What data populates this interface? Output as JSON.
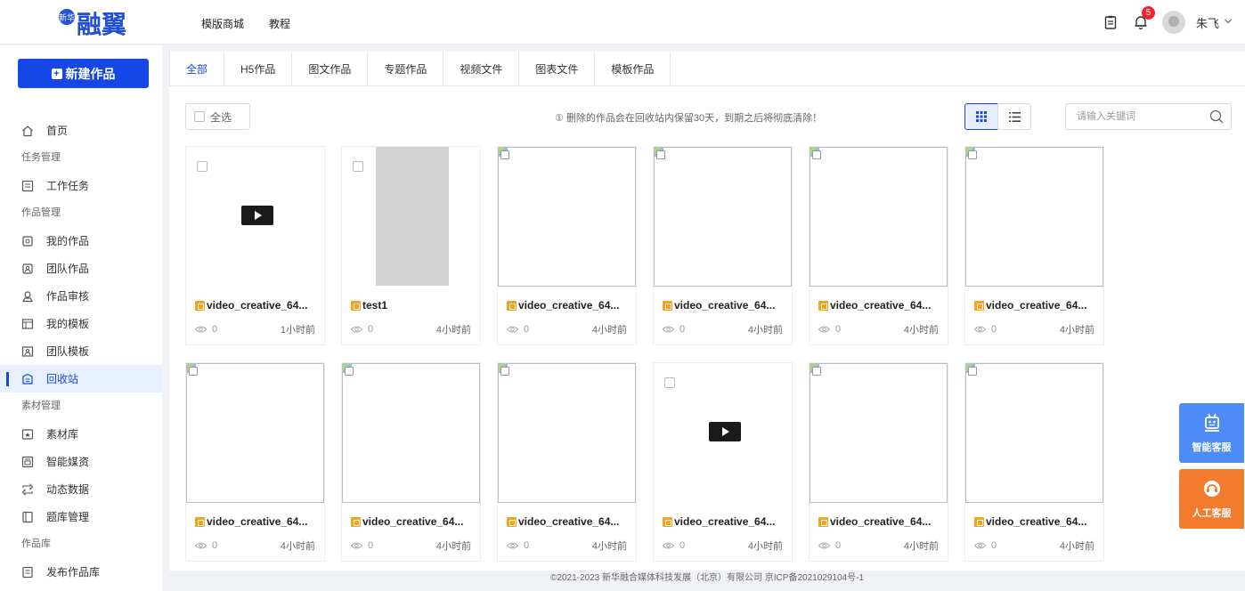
{
  "header": {
    "logo_mark": "新华",
    "logo_text": "融翼",
    "nav": [
      "模版商城",
      "教程"
    ],
    "notification_count": "5",
    "user_name": "朱飞"
  },
  "sidebar": {
    "new_button": "新建作品",
    "menu": [
      {
        "type": "item",
        "label": "首页",
        "icon": "home-icon"
      },
      {
        "type": "section",
        "label": "任务管理"
      },
      {
        "type": "item",
        "label": "工作任务",
        "icon": "task-icon"
      },
      {
        "type": "section",
        "label": "作品管理"
      },
      {
        "type": "item",
        "label": "我的作品",
        "icon": "my-works-icon"
      },
      {
        "type": "item",
        "label": "团队作品",
        "icon": "team-works-icon"
      },
      {
        "type": "item",
        "label": "作品审核",
        "icon": "review-icon"
      },
      {
        "type": "item",
        "label": "我的模板",
        "icon": "my-template-icon"
      },
      {
        "type": "item",
        "label": "团队模板",
        "icon": "team-template-icon"
      },
      {
        "type": "item",
        "label": "回收站",
        "icon": "recycle-bin-icon",
        "active": true
      },
      {
        "type": "section",
        "label": "素材管理"
      },
      {
        "type": "item",
        "label": "素材库",
        "icon": "material-library-icon"
      },
      {
        "type": "item",
        "label": "智能媒资",
        "icon": "smart-media-icon"
      },
      {
        "type": "item",
        "label": "动态数据",
        "icon": "dynamic-data-icon"
      },
      {
        "type": "item",
        "label": "题库管理",
        "icon": "question-bank-icon"
      },
      {
        "type": "section",
        "label": "作品库"
      },
      {
        "type": "item",
        "label": "发布作品库",
        "icon": "publish-library-icon"
      }
    ]
  },
  "tabs": [
    {
      "label": "全部",
      "active": true
    },
    {
      "label": "H5作品"
    },
    {
      "label": "图文作品"
    },
    {
      "label": "专题作品"
    },
    {
      "label": "视频文件"
    },
    {
      "label": "图表文件"
    },
    {
      "label": "模板作品"
    }
  ],
  "toolbar": {
    "select_all": "全选",
    "notice": "① 删除的作品会在回收站内保留30天，到期之后将彻底清除！",
    "search_placeholder": "请输入关键词"
  },
  "cards": [
    {
      "title": "video_creative_64...",
      "views": "0",
      "time": "1小时前",
      "thumb": "video"
    },
    {
      "title": "test1",
      "views": "0",
      "time": "4小时前",
      "thumb": "gray"
    },
    {
      "title": "video_creative_64...",
      "views": "0",
      "time": "4小时前",
      "thumb": "broken"
    },
    {
      "title": "video_creative_64...",
      "views": "0",
      "time": "4小时前",
      "thumb": "broken"
    },
    {
      "title": "video_creative_64...",
      "views": "0",
      "time": "4小时前",
      "thumb": "broken"
    },
    {
      "title": "video_creative_64...",
      "views": "0",
      "time": "4小时前",
      "thumb": "broken"
    },
    {
      "title": "video_creative_64...",
      "views": "0",
      "time": "4小时前",
      "thumb": "broken"
    },
    {
      "title": "video_creative_64...",
      "views": "0",
      "time": "4小时前",
      "thumb": "broken"
    },
    {
      "title": "video_creative_64...",
      "views": "0",
      "time": "4小时前",
      "thumb": "broken"
    },
    {
      "title": "video_creative_64...",
      "views": "0",
      "time": "4小时前",
      "thumb": "video"
    },
    {
      "title": "video_creative_64...",
      "views": "0",
      "time": "4小时前",
      "thumb": "broken"
    },
    {
      "title": "video_creative_64...",
      "views": "0",
      "time": "4小时前",
      "thumb": "broken"
    }
  ],
  "footer": "©2021-2023 新华融合媒体科技发展（北京）有限公司 京ICP备2021029104号-1",
  "float": {
    "ai_service": "智能客服",
    "human_service": "人工客服"
  },
  "colors": {
    "primary": "#1447e6",
    "orange": "#f27b2d",
    "ai_blue": "#4d8bf5"
  }
}
